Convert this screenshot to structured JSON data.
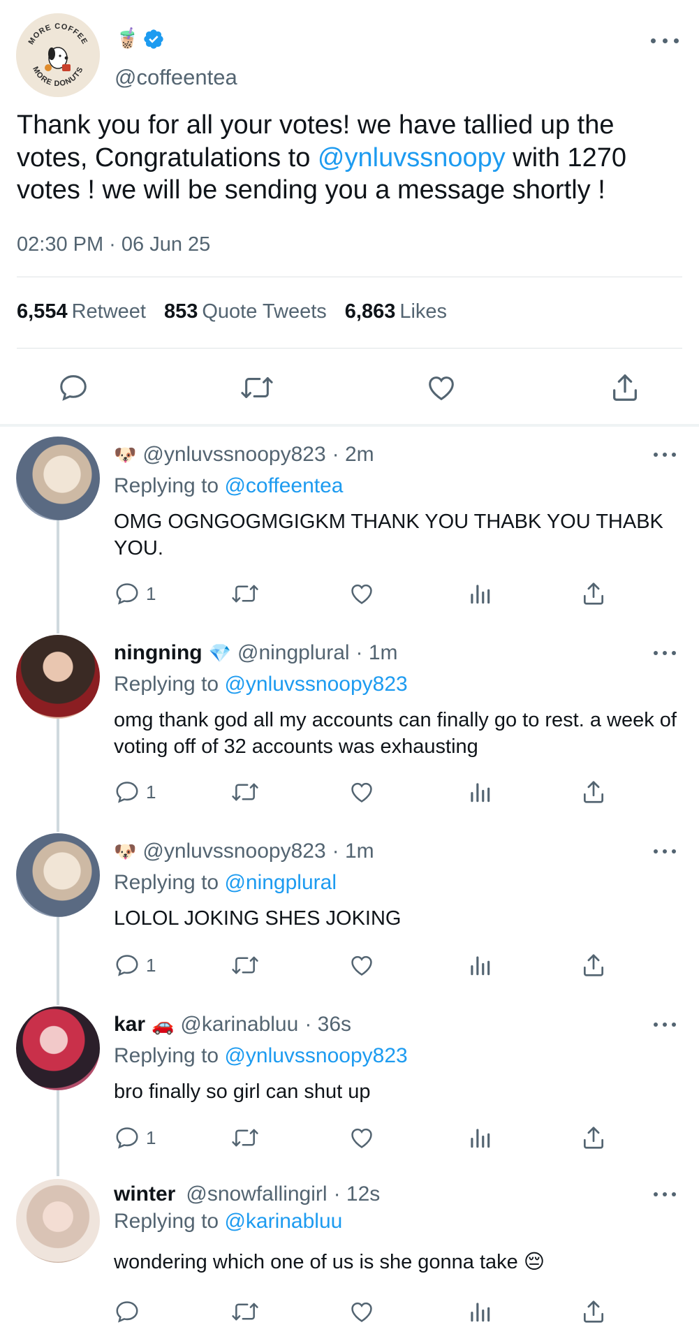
{
  "main": {
    "avatar_badge_top": "MORE COFFEE",
    "avatar_badge_bottom": "MORE DONUTS",
    "name_emoji": "🧋",
    "handle": "@coffeentea",
    "text_before": "Thank you for all your votes! we have tallied up the votes, Congratulations to ",
    "mention": "@ynluvssnoopy",
    "text_after": " with 1270 votes ! we will be sending you a message shortly !",
    "timestamp": "02:30 PM · 06 Jun 25",
    "stats": {
      "retweets": "6,554",
      "retweets_label": "Retweet",
      "quotes": "853",
      "quotes_label": "Quote Tweets",
      "likes": "6,863",
      "likes_label": "Likes"
    }
  },
  "replies": [
    {
      "name": "",
      "name_emoji": "🐶",
      "handle": "@ynluvssnoopy823",
      "time": "· 2m",
      "replying_label": "Replying to",
      "replying_to": "@coffeentea",
      "text": "OMG OGNGOGMGIGKM THANK YOU THABK YOU THABK YOU.",
      "reply_count": "1"
    },
    {
      "name": "ningning",
      "name_emoji": "💎",
      "handle": "@ningplural",
      "time": "· 1m",
      "replying_label": "Replying to",
      "replying_to": "@ynluvssnoopy823",
      "text": "omg thank god all my accounts can finally go to rest. a week of voting off of 32 accounts was exhausting",
      "reply_count": "1"
    },
    {
      "name": "",
      "name_emoji": "🐶",
      "handle": "@ynluvssnoopy823",
      "time": "· 1m",
      "replying_label": "Replying to",
      "replying_to": "@ningplural",
      "text": "LOLOL JOKING SHES JOKING",
      "reply_count": "1"
    },
    {
      "name": "kar",
      "name_emoji": "🚗",
      "handle": "@karinabluu",
      "time": "· 36s",
      "replying_label": "Replying to",
      "replying_to": "@ynluvssnoopy823",
      "text": "bro finally so girl can shut up",
      "reply_count": "1"
    },
    {
      "name": "winter",
      "name_emoji": "",
      "handle": "@snowfallingirl",
      "time": "· 12s",
      "replying_label": "Replying to",
      "replying_to": "@karinabluu",
      "text": "wondering which one of us is she gonna take 😔",
      "reply_count": ""
    }
  ],
  "colors": {
    "accent": "#1d9bf0",
    "text": "#0f1419",
    "muted": "#536471",
    "divider": "#dfe3e6",
    "thread_line": "#cfd9de"
  }
}
